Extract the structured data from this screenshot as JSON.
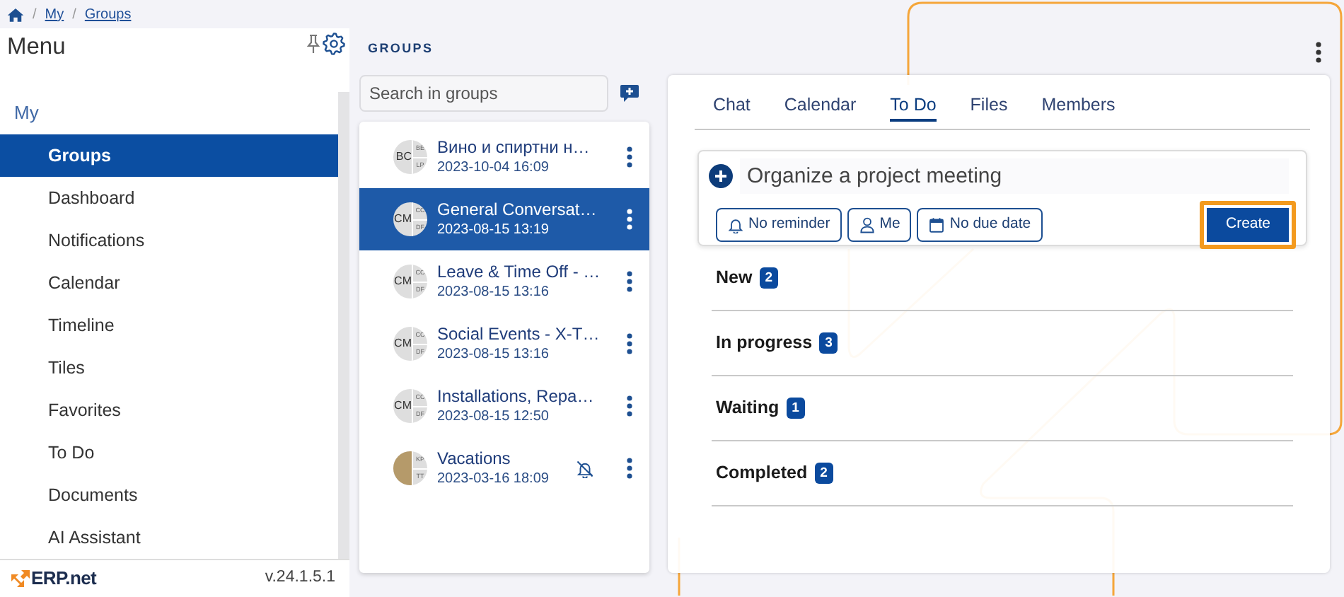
{
  "breadcrumb": [
    {
      "separator": "/",
      "label": "My"
    },
    {
      "separator": "/",
      "label": "Groups"
    }
  ],
  "sidebar": {
    "title": "Menu",
    "section": "My",
    "items": [
      {
        "label": "Groups",
        "selected": true
      },
      {
        "label": "Dashboard",
        "selected": false
      },
      {
        "label": "Notifications",
        "selected": false
      },
      {
        "label": "Calendar",
        "selected": false
      },
      {
        "label": "Timeline",
        "selected": false
      },
      {
        "label": "Tiles",
        "selected": false
      },
      {
        "label": "Favorites",
        "selected": false
      },
      {
        "label": "To Do",
        "selected": false
      },
      {
        "label": "Documents",
        "selected": false
      },
      {
        "label": "AI Assistant",
        "selected": false
      }
    ],
    "logo": "ERP.net",
    "version": "v.24.1.5.1"
  },
  "groups_panel": {
    "heading": "GROUPS",
    "search": {
      "placeholder": "Search in groups"
    },
    "groups": [
      {
        "title": "Вино и спиртни н…",
        "time": "2023-10-04 16:09",
        "avatar": {
          "kind": "initials",
          "main": "BC",
          "top": "BE",
          "bottom": "LP"
        },
        "selected": false,
        "muted": false
      },
      {
        "title": "General Conversat…",
        "time": "2023-08-15 13:19",
        "avatar": {
          "kind": "initials",
          "main": "CM",
          "top": "CC",
          "bottom": "DF"
        },
        "selected": true,
        "muted": false
      },
      {
        "title": "Leave & Time Off - …",
        "time": "2023-08-15 13:16",
        "avatar": {
          "kind": "initials",
          "main": "CM",
          "top": "CC",
          "bottom": "DF"
        },
        "selected": false,
        "muted": false
      },
      {
        "title": "Social Events - X-T…",
        "time": "2023-08-15 13:16",
        "avatar": {
          "kind": "initials",
          "main": "CM",
          "top": "CC",
          "bottom": "DF"
        },
        "selected": false,
        "muted": false
      },
      {
        "title": "Installations, Repa…",
        "time": "2023-08-15 12:50",
        "avatar": {
          "kind": "initials",
          "main": "CM",
          "top": "CC",
          "bottom": "DF"
        },
        "selected": false,
        "muted": false
      },
      {
        "title": "Vacations",
        "time": "2023-03-16 18:09",
        "avatar": {
          "kind": "photo",
          "top": "KP",
          "bottom": "TT"
        },
        "selected": false,
        "muted": true
      }
    ]
  },
  "detail": {
    "tabs": [
      {
        "label": "Chat",
        "selected": false
      },
      {
        "label": "Calendar",
        "selected": false
      },
      {
        "label": "To Do",
        "selected": true
      },
      {
        "label": "Files",
        "selected": false
      },
      {
        "label": "Members",
        "selected": false
      }
    ],
    "new_todo": {
      "value": "Organize a project meeting",
      "buttons": [
        {
          "kind": "reminder",
          "label": "No reminder"
        },
        {
          "kind": "assignee",
          "label": "Me"
        },
        {
          "kind": "due_date",
          "label": "No due date"
        }
      ],
      "create": {
        "label": "Create",
        "focused": true
      }
    },
    "sections": [
      {
        "label": "New",
        "count": "2"
      },
      {
        "label": "In progress",
        "count": "3"
      },
      {
        "label": "Waiting",
        "count": "1"
      },
      {
        "label": "Completed",
        "count": "2"
      }
    ]
  }
}
